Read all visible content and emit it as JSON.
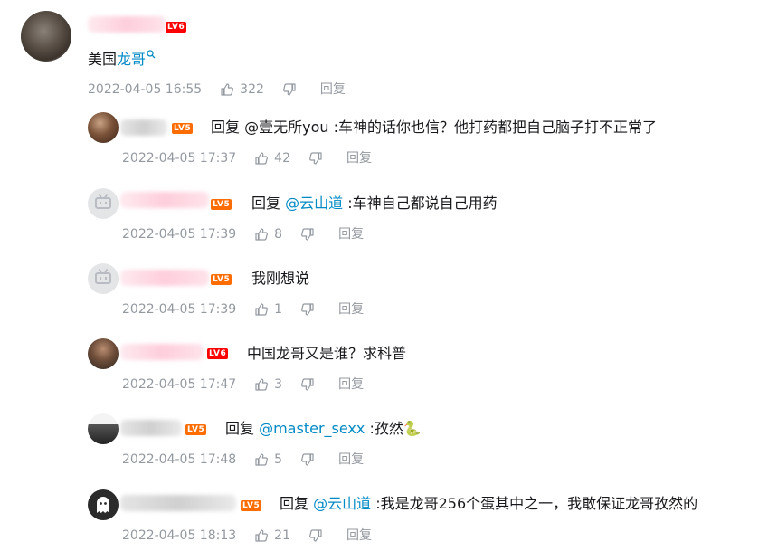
{
  "level_badges": [
    "LV6",
    "LV5"
  ],
  "main_comment": {
    "level": "LV6",
    "text_prefix": "美国",
    "keyword": "龙哥",
    "keyword_icon": "search-icon",
    "time": "2022-04-05 16:55",
    "likes": "322",
    "reply_label": "回复"
  },
  "replies": [
    {
      "level": "LV5",
      "reply_word": "回复 ",
      "mention": "@壹无所you",
      "text": " :车神的话你也信？他打药都把自己脑子打不正常了",
      "time": "2022-04-05 17:37",
      "likes": "42",
      "reply_label": "回复"
    },
    {
      "level": "LV5",
      "reply_word": "回复 ",
      "mention": "@云山道",
      "text": " :车神自己都说自己用药",
      "time": "2022-04-05 17:39",
      "likes": "8",
      "reply_label": "回复"
    },
    {
      "level": "LV5",
      "text": "我刚想说",
      "time": "2022-04-05 17:39",
      "likes": "1",
      "reply_label": "回复"
    },
    {
      "level": "LV6",
      "text": "中国龙哥又是谁？求科普",
      "time": "2022-04-05 17:47",
      "likes": "3",
      "reply_label": "回复"
    },
    {
      "level": "LV5",
      "reply_word": "回复 ",
      "mention": "@master_sexx",
      "text": " :孜然",
      "emoji": "🐍",
      "time": "2022-04-05 17:48",
      "likes": "5",
      "reply_label": "回复"
    },
    {
      "level": "LV5",
      "reply_word": "回复 ",
      "mention": "@云山道",
      "text": " :我是龙哥256个蛋其中之一，我敢保证龙哥孜然的",
      "time": "2022-04-05 18:13",
      "likes": "21",
      "reply_label": "回复"
    }
  ],
  "colors": {
    "link": "#008ac5",
    "meta": "#9499a0",
    "level_lv5": "#ff6c00",
    "level_lv6": "#ff0000"
  },
  "icons": [
    "thumb-up-icon",
    "thumb-down-icon",
    "bilibili-tv-icon"
  ]
}
